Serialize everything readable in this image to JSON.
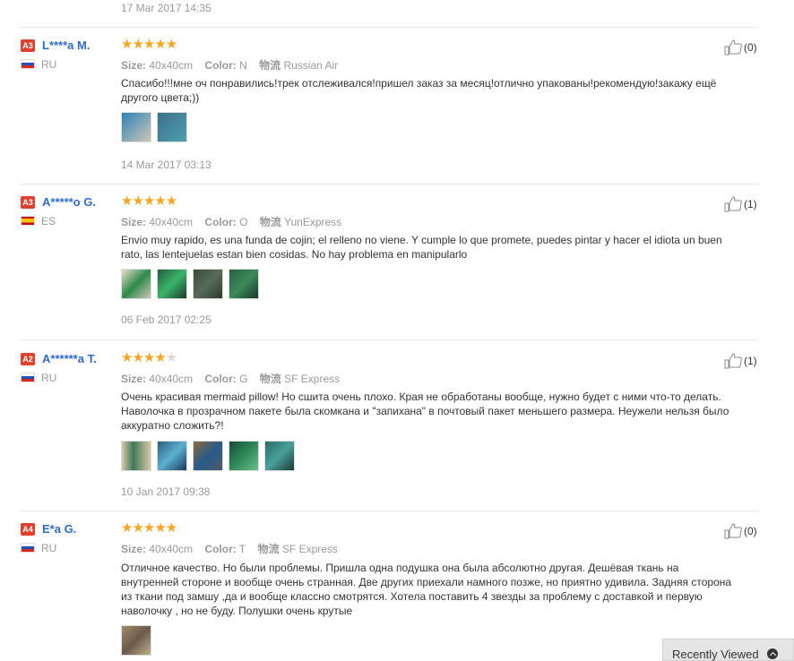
{
  "top_date": "17 Mar 2017 14:35",
  "labels": {
    "size": "Size:",
    "color": "Color:",
    "shipping": "物流"
  },
  "recently_viewed": "Recently Viewed",
  "reviews": [
    {
      "level": "A3",
      "level_color": "#e0412f",
      "name": "L****a M.",
      "country": "RU",
      "flag": "ru",
      "stars": 5,
      "size": "40x40cm",
      "color": "N",
      "shipping": "Russian Air",
      "text": "Спасибо!!!мне оч понравились!трек отслеживался!пришел заказ за месяц!отлично упакованы!рекомендую!закажу ещё другого цвета;))",
      "thumbs": [
        "#4a7fa0",
        "#3d6f8a"
      ],
      "date": "14 Mar 2017 03:13",
      "likes": "(0)"
    },
    {
      "level": "A3",
      "level_color": "#e0412f",
      "name": "A*****o G.",
      "country": "ES",
      "flag": "es",
      "stars": 5,
      "size": "40x40cm",
      "color": "O",
      "shipping": "YunExpress",
      "text": "Envio muy rapido, es una funda de cojin; el relleno no viene. Y cumple lo que promete, puedes pintar y hacer el idiota un buen rato, las lentejuelas estan bien cosidas. No hay problema en manipularlo",
      "thumbs": [
        "#2e7d4a",
        "#1f5e3a",
        "#3a4a3c",
        "#2b6045"
      ],
      "date": "06 Feb 2017 02:25",
      "likes": "(1)"
    },
    {
      "level": "A2",
      "level_color": "#e0412f",
      "name": "A******a T.",
      "country": "RU",
      "flag": "ru",
      "stars": 4,
      "size": "40x40cm",
      "color": "G",
      "shipping": "SF Express",
      "text": "Очень красивая mermaid pillow! Но сшита очень плохо. Края не обработаны вообще, нужно будет с ними что-то делать. Наволочка в прозрачном пакете была скомкана и \"запихана\" в почтовый пакет меньшего размера. Неужели нельзя было аккуратно сложить?!",
      "thumbs": [
        "#3f7a5a",
        "#2c5f7c",
        "#4a5a6a",
        "#2f8a5a",
        "#2a6a66"
      ],
      "date": "10 Jan 2017 09:38",
      "likes": "(1)"
    },
    {
      "level": "A4",
      "level_color": "#e0412f",
      "name": "E*a G.",
      "country": "RU",
      "flag": "ru",
      "stars": 5,
      "size": "40x40cm",
      "color": "T",
      "shipping": "SF Express",
      "text": "Отличное качество. Но были проблемы. Пришла одна подушка она была абсолютно другая. Дешёвая ткань на внутренней стороне и вообще очень странная. Две других приехали намного позже, но приятно удивила. Задняя сторона из ткани под замшу ,да и вообще классно смотрятся. Хотела поставить 4 звезды за проблему с доставкой и первую наволочку , но не буду. Полушки очень крутые",
      "thumbs": [
        "#8a7a62"
      ],
      "date": "",
      "likes": "(0)"
    }
  ]
}
